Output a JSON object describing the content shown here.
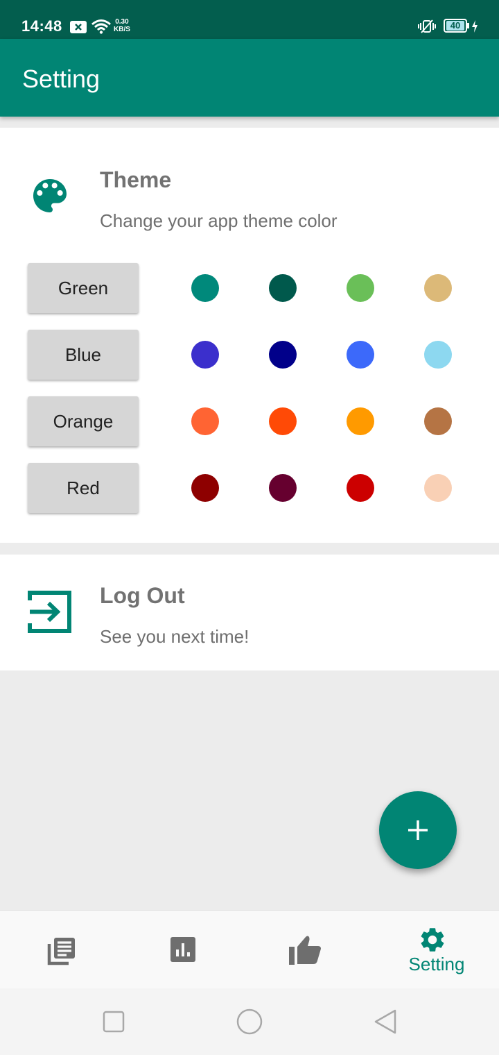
{
  "status_bar": {
    "time": "14:48",
    "speed_value": "0.30",
    "speed_unit": "KB/S",
    "battery": "40"
  },
  "app_bar": {
    "title": "Setting"
  },
  "theme_card": {
    "title": "Theme",
    "subtitle": "Change your app theme color",
    "icon": "palette-icon",
    "rows": [
      {
        "label": "Green",
        "colors": [
          "#00897b",
          "#00594c",
          "#6abf58",
          "#dcb978"
        ]
      },
      {
        "label": "Blue",
        "colors": [
          "#3b2fcc",
          "#01008a",
          "#3c69fa",
          "#8dd8f0"
        ]
      },
      {
        "label": "Orange",
        "colors": [
          "#ff6433",
          "#ff4a06",
          "#ff9a00",
          "#b57444"
        ]
      },
      {
        "label": "Red",
        "colors": [
          "#8e0000",
          "#66002f",
          "#cc0000",
          "#f9d0b5"
        ]
      }
    ]
  },
  "logout_card": {
    "title": "Log Out",
    "subtitle": "See you next time!",
    "icon": "exit-icon"
  },
  "fab": {
    "icon": "plus-icon"
  },
  "bottom_nav": {
    "items": [
      {
        "icon": "news-icon"
      },
      {
        "icon": "chart-icon"
      },
      {
        "icon": "thumb-up-icon"
      },
      {
        "icon": "gear-icon",
        "label": "Setting",
        "active": true
      }
    ]
  },
  "system_nav": {
    "items": [
      "recents-icon",
      "home-icon",
      "back-icon"
    ]
  },
  "colors": {
    "primary": "#018574",
    "primary_dark": "#035e4e"
  }
}
